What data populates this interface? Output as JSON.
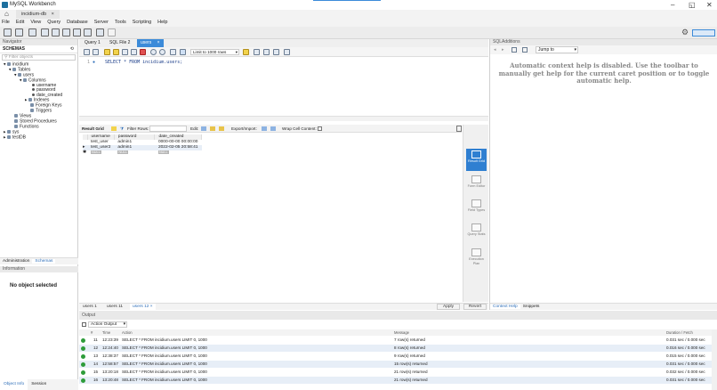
{
  "window": {
    "title": "MySQL Workbench",
    "min": "–",
    "restore": "◱",
    "close": "✕"
  },
  "connection_tab": {
    "label": "incidium-db",
    "close": "×"
  },
  "menu": [
    "File",
    "Edit",
    "View",
    "Query",
    "Database",
    "Server",
    "Tools",
    "Scripting",
    "Help"
  ],
  "navigator": {
    "header": "Navigator",
    "schemas_label": "SCHEMAS",
    "filter_placeholder": "Filter objects",
    "tree": [
      {
        "label": "incidium",
        "level": 0,
        "kind": "db"
      },
      {
        "label": "Tables",
        "level": 1,
        "kind": "folder"
      },
      {
        "label": "users",
        "level": 2,
        "kind": "table"
      },
      {
        "label": "Columns",
        "level": 3,
        "kind": "folder"
      },
      {
        "label": "username",
        "level": 4,
        "kind": "col"
      },
      {
        "label": "password",
        "level": 4,
        "kind": "col"
      },
      {
        "label": "date_created",
        "level": 4,
        "kind": "col"
      },
      {
        "label": "Indexes",
        "level": 3,
        "kind": "folder"
      },
      {
        "label": "Foreign Keys",
        "level": 3,
        "kind": "folder"
      },
      {
        "label": "Triggers",
        "level": 3,
        "kind": "folder"
      },
      {
        "label": "Views",
        "level": 1,
        "kind": "folder"
      },
      {
        "label": "Stored Procedures",
        "level": 1,
        "kind": "folder"
      },
      {
        "label": "Functions",
        "level": 1,
        "kind": "folder"
      },
      {
        "label": "sys",
        "level": 0,
        "kind": "db"
      },
      {
        "label": "testDB",
        "level": 0,
        "kind": "db"
      }
    ],
    "tabs": [
      "Administration",
      "Schemas"
    ],
    "info_header": "Information",
    "no_object": "No object selected",
    "bottom_tabs": [
      "Object Info",
      "Session"
    ]
  },
  "editor": {
    "tabs": [
      "Query 1",
      "SQL File 2",
      "users"
    ],
    "limit": "Limit to 1000 rows",
    "line_no": "1",
    "sql": "SELECT * FROM incidium.users;"
  },
  "results": {
    "toolbar": {
      "result_grid": "Result Grid",
      "filter_rows": "Filter Rows:",
      "edit": "Edit:",
      "export": "Export/Import:",
      "wrap": "Wrap Cell Content:"
    },
    "columns": [
      "username",
      "password",
      "date_created"
    ],
    "rows": [
      [
        "test_user",
        "admin1",
        "0000-00-00 00:00:00"
      ],
      [
        "test_user2",
        "admin1",
        "2022-02-05 20:58:41"
      ]
    ],
    "null_badge": "NULL"
  },
  "side_panel": [
    "Result Grid",
    "Form Editor",
    "Field Types",
    "Query Stats",
    "Execution Plan"
  ],
  "result_tabs": [
    "users 1",
    "users 11",
    "users 12"
  ],
  "apply": "Apply",
  "revert": "Revert",
  "sql_additions": {
    "header": "SQLAdditions",
    "jump_to": "Jump to",
    "message": "Automatic context help is disabled. Use the toolbar to manually get help for the current caret position or to toggle automatic help.",
    "tabs": [
      "Context Help",
      "Snippets"
    ]
  },
  "output": {
    "header": "Output",
    "mode": "Action Output",
    "columns": [
      "#",
      "Time",
      "Action",
      "Message",
      "Duration / Fetch"
    ],
    "rows": [
      {
        "n": "11",
        "time": "12:23:39",
        "action": "SELECT * FROM incidium.users LIMIT 0, 1000",
        "message": "7 row(s) returned",
        "duration": "0.031 sec / 0.000 sec"
      },
      {
        "n": "12",
        "time": "12:24:40",
        "action": "SELECT * FROM incidium.users LIMIT 0, 1000",
        "message": "8 row(s) returned",
        "duration": "0.016 sec / 0.000 sec"
      },
      {
        "n": "13",
        "time": "12:38:37",
        "action": "SELECT * FROM incidium.users LIMIT 0, 1000",
        "message": "9 row(s) returned",
        "duration": "0.015 sec / 0.000 sec"
      },
      {
        "n": "14",
        "time": "12:58:57",
        "action": "SELECT * FROM incidium.users LIMIT 0, 1000",
        "message": "15 row(s) returned",
        "duration": "0.031 sec / 0.000 sec"
      },
      {
        "n": "15",
        "time": "13:20:18",
        "action": "SELECT * FROM incidium.users LIMIT 0, 1000",
        "message": "21 row(s) returned",
        "duration": "0.032 sec / 0.000 sec"
      },
      {
        "n": "16",
        "time": "13:20:48",
        "action": "SELECT * FROM incidium.users LIMIT 0, 1000",
        "message": "21 row(s) returned",
        "duration": "0.031 sec / 0.000 sec"
      }
    ]
  }
}
